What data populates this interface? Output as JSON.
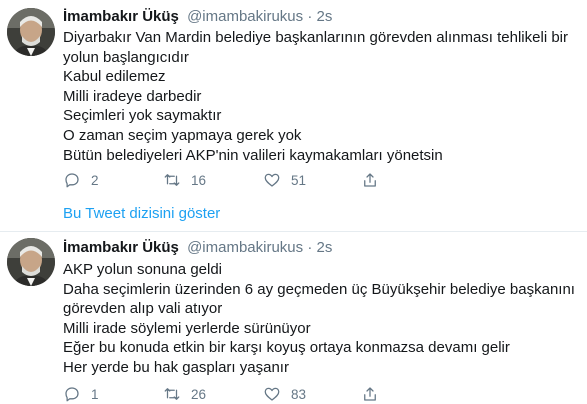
{
  "tweets": [
    {
      "name": "İmambakır Üküş",
      "handle": "@imambakirukus",
      "separator": "·",
      "time": "2s",
      "lines": [
        "Diyarbakır Van Mardin belediye başkanlarının görevden alınması tehlikeli bir",
        "yolun başlangıcıdır",
        "Kabul edilemez",
        "Milli iradeye darbedir",
        "Seçimleri yok saymaktır",
        "O zaman seçim yapmaya gerek yok",
        "Bütün belediyeleri AKP'nin valileri kaymakamları yönetsin"
      ],
      "actions": {
        "reply": "2",
        "retweet": "16",
        "like": "51"
      },
      "thread_link": "Bu Tweet dizisini göster"
    },
    {
      "name": "İmambakır Üküş",
      "handle": "@imambakirukus",
      "separator": "·",
      "time": "2s",
      "lines": [
        "AKP yolun sonuna geldi",
        "Daha seçimlerin üzerinden 6 ay geçmeden üç Büyükşehir belediye başkanını",
        "görevden alıp vali atıyor",
        "Milli irade söylemi yerlerde sürünüyor",
        "Eğer bu konuda etkin bir karşı koyuş ortaya konmazsa devamı gelir",
        "Her yerde bu hak gaspları yaşanır"
      ],
      "actions": {
        "reply": "1",
        "retweet": "26",
        "like": "83"
      }
    }
  ],
  "icons": {
    "reply": "reply-icon",
    "retweet": "retweet-icon",
    "like": "like-icon",
    "share": "share-icon"
  },
  "colors": {
    "link": "#1da1f2",
    "muted": "#657786",
    "text": "#14171a",
    "divider": "#e6ecf0"
  }
}
